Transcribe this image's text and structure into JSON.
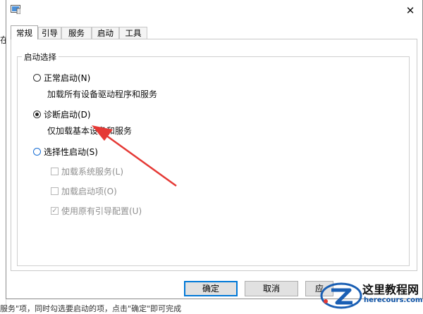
{
  "background": {
    "left_char": "在",
    "bottom_text": "服务\"项，同时勾选要启动的项，点击\"确定\"即可完成"
  },
  "dialog": {
    "tabs": [
      {
        "label": "常规",
        "active": true
      },
      {
        "label": "引导",
        "active": false
      },
      {
        "label": "服务",
        "active": false
      },
      {
        "label": "启动",
        "active": false
      },
      {
        "label": "工具",
        "active": false
      }
    ],
    "group_title": "启动选择",
    "options": {
      "normal": {
        "label": "正常启动(N)",
        "desc": "加载所有设备驱动程序和服务",
        "selected": false
      },
      "diagnostic": {
        "label": "诊断启动(D)",
        "desc": "仅加载基本设备和服务",
        "selected": true
      },
      "selective": {
        "label": "选择性启动(S)",
        "selected": false
      }
    },
    "sub_options": [
      {
        "label": "加载系统服务(L)",
        "checked": false,
        "enabled": false
      },
      {
        "label": "加载启动项(O)",
        "checked": false,
        "enabled": false
      },
      {
        "label": "使用原有引导配置(U)",
        "checked": true,
        "enabled": false
      }
    ],
    "buttons": {
      "ok": "确定",
      "cancel": "取消",
      "apply": "应"
    }
  },
  "watermark": {
    "title": "这里教程网",
    "url": "herecours.com"
  },
  "colors": {
    "annotation_arrow": "#e53935",
    "focus_blue": "#0078d7"
  }
}
